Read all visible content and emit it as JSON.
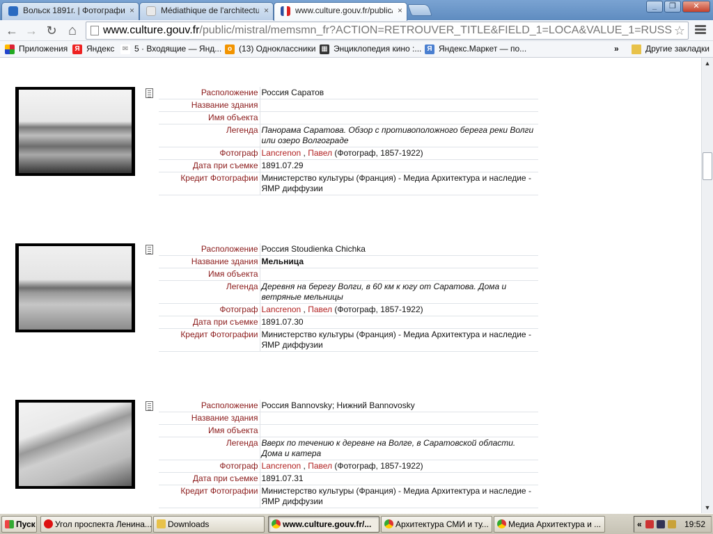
{
  "tabs": [
    {
      "label": "Вольск 1891г. | Фотографи",
      "close": "×",
      "color": "#2a6ac0"
    },
    {
      "label": "Médiathique de l'architectur",
      "close": "×",
      "color": "#e9e9e9"
    },
    {
      "label": "www.culture.gouv.fr/public/",
      "close": "×",
      "color": "#2d4fa0"
    }
  ],
  "window_buttons": {
    "minimize": "_",
    "restore": "❐",
    "close": "✕"
  },
  "toolbar": {
    "back": "←",
    "forward": "→",
    "reload": "↻",
    "home": "⌂",
    "url_host": "www.culture.gouv.fr",
    "url_path": "/public/mistral/memsmn_fr?ACTION=RETROUVER_TITLE&FIELD_1=LOCA&VALUE_1=RUSS",
    "star": "☆"
  },
  "bookmarks": [
    {
      "label": "Приложения",
      "icon": "apps-icon",
      "color": "#d23"
    },
    {
      "label": "Яндекс",
      "icon": "yandex-icon",
      "glyph": "Я",
      "color": "#e22"
    },
    {
      "label": "5 · Входящие — Янд...",
      "icon": "mail-icon",
      "glyph": "✉",
      "color": "#999"
    },
    {
      "label": "(13) Одноклассники",
      "icon": "odnoklassniki-icon",
      "glyph": "о",
      "color": "#f29400"
    },
    {
      "label": "Энциклопедия кино :...",
      "icon": "film-icon",
      "glyph": "▦",
      "color": "#333"
    },
    {
      "label": "Яндекс.Маркет — по...",
      "icon": "market-icon",
      "glyph": "Я",
      "color": "#4a7fd0"
    }
  ],
  "bookmarks_overflow": "»",
  "other_bookmarks": "Другие закладки",
  "field_labels": {
    "location": "Расположение",
    "building": "Название здания",
    "object": "Имя объекта",
    "legend": "Легенда",
    "photographer": "Фотограф",
    "date": "Дата при съемке",
    "credit": "Кредит Фотографии"
  },
  "records": [
    {
      "location": "Россия Саратов",
      "building": "",
      "object": "",
      "legend": "Панорама Саратова. Обзор с противоположного берега реки Волги или озеро Волгограде",
      "photographer_surname": "Lancrenon",
      "photographer_sep": " , ",
      "photographer_name": "Павел",
      "photographer_role": " (Фотограф, 1857-1922)",
      "date": "1891.07.29",
      "credit": "Министерство культуры (Франция) - Медиа Архитектура и наследие - ЯМР диффузии"
    },
    {
      "location": "Россия Stoudienka Chichka",
      "building": "Мельница",
      "object": "",
      "legend": "Деревня на берегу Волги, в 60 км к югу от Саратова. Дома и ветряные мельницы",
      "photographer_surname": "Lancrenon",
      "photographer_sep": " , ",
      "photographer_name": "Павел",
      "photographer_role": " (Фотограф, 1857-1922)",
      "date": "1891.07.30",
      "credit": "Министерство культуры (Франция) - Медиа Архитектура и наследие - ЯМР диффузии"
    },
    {
      "location": "Россия Bannovsky; Нижний Bannovosky",
      "building": "",
      "object": "",
      "legend": "Вверх по течению к деревне на Волге, в Саратовской области. Дома и катера",
      "photographer_surname": "Lancrenon",
      "photographer_sep": " , ",
      "photographer_name": "Павел",
      "photographer_role": " (Фотограф, 1857-1922)",
      "date": "1891.07.31",
      "credit": "Министерство культуры (Франция) - Медиа Архитектура и наследие - ЯМР диффузии"
    }
  ],
  "taskbar": {
    "start": "Пуск",
    "tasks": [
      {
        "label": "Угол проспекта Ленина...",
        "icon": "opera-icon",
        "color": "#d11"
      },
      {
        "label": "Downloads",
        "icon": "folder-icon",
        "color": "#e8c24a"
      },
      {
        "label": "www.culture.gouv.fr/...",
        "icon": "chrome-icon",
        "color": "#3a8d3a"
      },
      {
        "label": "Архитектура СМИ и ту...",
        "icon": "chrome-icon",
        "color": "#3a8d3a"
      },
      {
        "label": "Медиа Архитектура и ...",
        "icon": "chrome-icon",
        "color": "#3a8d3a"
      }
    ],
    "tray_expand": "«",
    "clock": "19:52"
  },
  "scrollbar": {
    "up": "▲",
    "down": "▼"
  }
}
